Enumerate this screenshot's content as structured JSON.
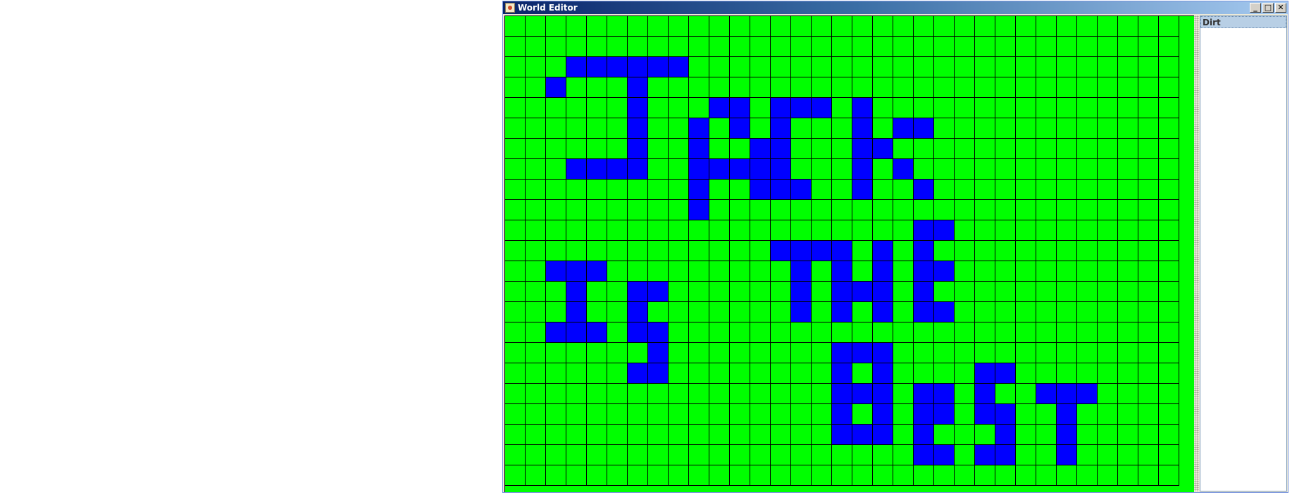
{
  "window": {
    "title": "World Editor",
    "buttons": {
      "minimize": "_",
      "maximize": "□",
      "close": "✕"
    }
  },
  "tile_list": {
    "items": [
      "Dirt"
    ]
  },
  "grid": {
    "cols": 33,
    "rows": 23,
    "ground_tile": "grass",
    "ground_color": "#00ff00",
    "wall_color": "#0000ff",
    "gridline_color": "#000000",
    "wall_cells": [
      [
        2,
        3
      ],
      [
        2,
        4
      ],
      [
        2,
        5
      ],
      [
        2,
        6
      ],
      [
        2,
        7
      ],
      [
        2,
        8
      ],
      [
        3,
        2
      ],
      [
        3,
        6
      ],
      [
        4,
        6
      ],
      [
        4,
        10
      ],
      [
        4,
        11
      ],
      [
        4,
        13
      ],
      [
        4,
        14
      ],
      [
        4,
        15
      ],
      [
        4,
        17
      ],
      [
        5,
        6
      ],
      [
        5,
        9
      ],
      [
        5,
        11
      ],
      [
        5,
        13
      ],
      [
        5,
        17
      ],
      [
        5,
        19
      ],
      [
        5,
        20
      ],
      [
        6,
        6
      ],
      [
        6,
        9
      ],
      [
        6,
        12
      ],
      [
        6,
        13
      ],
      [
        6,
        17
      ],
      [
        6,
        18
      ],
      [
        7,
        3
      ],
      [
        7,
        4
      ],
      [
        7,
        5
      ],
      [
        7,
        6
      ],
      [
        7,
        9
      ],
      [
        7,
        10
      ],
      [
        7,
        11
      ],
      [
        7,
        12
      ],
      [
        7,
        13
      ],
      [
        7,
        17
      ],
      [
        7,
        19
      ],
      [
        8,
        9
      ],
      [
        8,
        12
      ],
      [
        8,
        13
      ],
      [
        8,
        14
      ],
      [
        8,
        17
      ],
      [
        8,
        20
      ],
      [
        9,
        9
      ],
      [
        10,
        20
      ],
      [
        10,
        21
      ],
      [
        11,
        13
      ],
      [
        11,
        14
      ],
      [
        11,
        15
      ],
      [
        11,
        16
      ],
      [
        11,
        18
      ],
      [
        11,
        20
      ],
      [
        12,
        2
      ],
      [
        12,
        3
      ],
      [
        12,
        4
      ],
      [
        12,
        14
      ],
      [
        12,
        16
      ],
      [
        12,
        18
      ],
      [
        12,
        20
      ],
      [
        12,
        21
      ],
      [
        13,
        3
      ],
      [
        13,
        6
      ],
      [
        13,
        7
      ],
      [
        13,
        14
      ],
      [
        13,
        16
      ],
      [
        13,
        17
      ],
      [
        13,
        18
      ],
      [
        13,
        20
      ],
      [
        14,
        3
      ],
      [
        14,
        6
      ],
      [
        14,
        14
      ],
      [
        14,
        16
      ],
      [
        14,
        18
      ],
      [
        14,
        20
      ],
      [
        14,
        21
      ],
      [
        15,
        2
      ],
      [
        15,
        3
      ],
      [
        15,
        4
      ],
      [
        15,
        6
      ],
      [
        15,
        7
      ],
      [
        16,
        7
      ],
      [
        16,
        16
      ],
      [
        16,
        17
      ],
      [
        16,
        18
      ],
      [
        17,
        6
      ],
      [
        17,
        7
      ],
      [
        17,
        16
      ],
      [
        17,
        18
      ],
      [
        17,
        23
      ],
      [
        17,
        24
      ],
      [
        18,
        16
      ],
      [
        18,
        17
      ],
      [
        18,
        18
      ],
      [
        18,
        20
      ],
      [
        18,
        21
      ],
      [
        18,
        23
      ],
      [
        18,
        26
      ],
      [
        18,
        27
      ],
      [
        18,
        28
      ],
      [
        19,
        16
      ],
      [
        19,
        18
      ],
      [
        19,
        20
      ],
      [
        19,
        21
      ],
      [
        19,
        23
      ],
      [
        19,
        24
      ],
      [
        19,
        27
      ],
      [
        20,
        16
      ],
      [
        20,
        17
      ],
      [
        20,
        18
      ],
      [
        20,
        20
      ],
      [
        20,
        24
      ],
      [
        20,
        27
      ],
      [
        21,
        20
      ],
      [
        21,
        21
      ],
      [
        21,
        23
      ],
      [
        21,
        24
      ],
      [
        21,
        27
      ]
    ]
  }
}
